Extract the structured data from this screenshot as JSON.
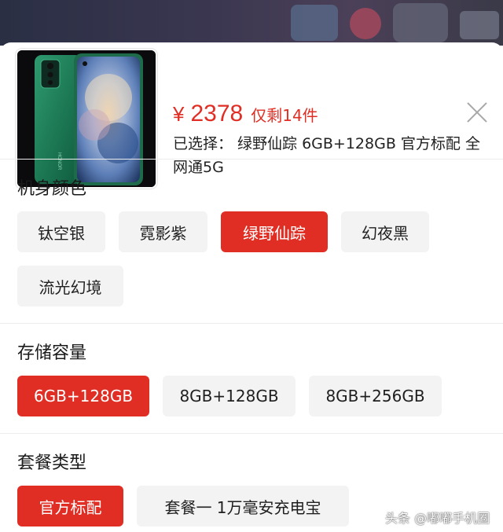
{
  "product": {
    "image": "green-smartphone-photo",
    "brand_on_device": "HONOR",
    "price_symbol": "¥",
    "price": "2378",
    "stock_text": "仅剩14件",
    "selected_text": "已选择： 绿野仙踪 6GB+128GB 官方标配 全网通5G"
  },
  "colors": {
    "accent": "#e02e24",
    "option_bg": "#f3f3f3"
  },
  "sections": {
    "color": {
      "title": "机身颜色",
      "options": [
        "钛空银",
        "霓影紫",
        "绿野仙踪",
        "幻夜黑",
        "流光幻境"
      ],
      "selected": "绿野仙踪"
    },
    "storage": {
      "title": "存储容量",
      "options": [
        "6GB+128GB",
        "8GB+128GB",
        "8GB+256GB"
      ],
      "selected": "6GB+128GB"
    },
    "bundle": {
      "title": "套餐类型",
      "options": [
        "官方标配",
        "套餐一 1万毫安充电宝"
      ],
      "selected": "官方标配"
    }
  },
  "watermark": "头条 @嘟嘟手机圈"
}
